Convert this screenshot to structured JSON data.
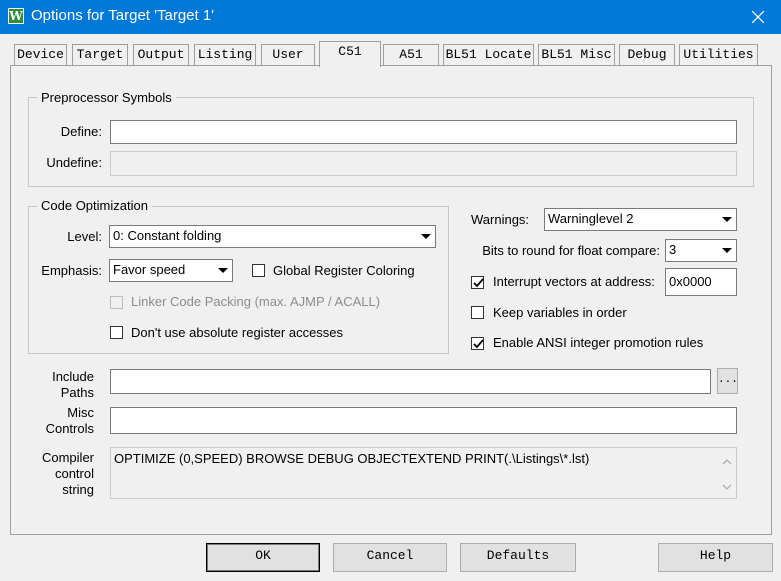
{
  "window": {
    "title": "Options for Target 'Target 1'",
    "app_icon_letter": "W"
  },
  "tabs": [
    {
      "label": "Device"
    },
    {
      "label": "Target"
    },
    {
      "label": "Output"
    },
    {
      "label": "Listing"
    },
    {
      "label": "User"
    },
    {
      "label": "C51",
      "active": true
    },
    {
      "label": "A51"
    },
    {
      "label": "BL51 Locate"
    },
    {
      "label": "BL51 Misc"
    },
    {
      "label": "Debug"
    },
    {
      "label": "Utilities"
    }
  ],
  "preprocessor": {
    "title": "Preprocessor Symbols",
    "define_label": "Define:",
    "define_value": "",
    "undefine_label": "Undefine:",
    "undefine_value": ""
  },
  "code_optimization": {
    "title": "Code Optimization",
    "level_label": "Level:",
    "level_value": "0: Constant folding",
    "emphasis_label": "Emphasis:",
    "emphasis_value": "Favor speed",
    "global_register_coloring": {
      "label": "Global Register Coloring",
      "checked": false
    },
    "linker_code_packing": {
      "label": "Linker Code Packing (max. AJMP / ACALL)",
      "checked": false,
      "enabled": false
    },
    "dont_use_absolute": {
      "label": "Don't use absolute register accesses",
      "checked": false
    }
  },
  "right_options": {
    "warnings_label": "Warnings:",
    "warnings_value": "Warninglevel 2",
    "bits_label": "Bits to round for float compare:",
    "bits_value": "3",
    "interrupt_vectors": {
      "label": "Interrupt vectors at address:",
      "checked": true,
      "value": "0x0000"
    },
    "keep_variables": {
      "label": "Keep variables in order",
      "checked": false
    },
    "ansi_promotion": {
      "label": "Enable ANSI integer promotion rules",
      "checked": true
    }
  },
  "paths": {
    "include_label_1": "Include",
    "include_label_2": "Paths",
    "include_value": "",
    "browse_label": "...",
    "misc_label_1": "Misc",
    "misc_label_2": "Controls",
    "misc_value": "",
    "compiler_label_1": "Compiler",
    "compiler_label_2": "control",
    "compiler_label_3": "string",
    "compiler_value": "OPTIMIZE (0,SPEED) BROWSE DEBUG OBJECTEXTEND PRINT(.\\Listings\\*.lst)"
  },
  "buttons": {
    "ok": "OK",
    "cancel": "Cancel",
    "defaults": "Defaults",
    "help": "Help"
  },
  "colors": {
    "titlebar": "#0078d7",
    "dialog_bg": "#f0f0f0"
  }
}
